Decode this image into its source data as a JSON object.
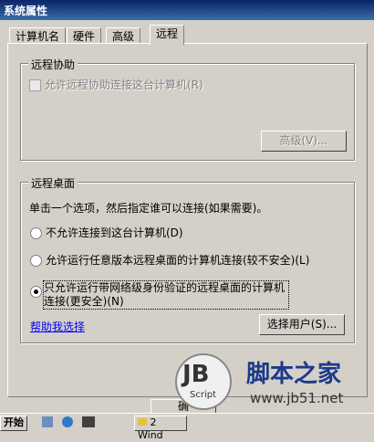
{
  "window": {
    "title": "系统属性"
  },
  "tabs": [
    "计算机名",
    "硬件",
    "高级",
    "远程"
  ],
  "remote_assistance": {
    "group_title": "远程协助",
    "checkbox_label": "允许远程协助连接这台计算机(R)",
    "advanced_button": "高级(V)..."
  },
  "remote_desktop": {
    "group_title": "远程桌面",
    "instruction": "单击一个选项，然后指定谁可以连接(如果需要)。",
    "options": [
      "不允许连接到这台计算机(D)",
      "允许运行任意版本远程桌面的计算机连接(较不安全)(L)",
      "只允许运行带网络级身份验证的远程桌面的计算机",
      "连接(更安全)(N)"
    ],
    "selected_index": 2,
    "help_link": "帮助我选择",
    "select_users_button": "选择用户(S)..."
  },
  "dialog_buttons": {
    "ok_partial": "确"
  },
  "taskbar": {
    "start_label": "开始",
    "task_label": "2 Wind"
  },
  "watermark": {
    "brand_mark": "JB",
    "script_text": "Script",
    "site_name": "脚本之家",
    "url": "www.jb51.net"
  }
}
